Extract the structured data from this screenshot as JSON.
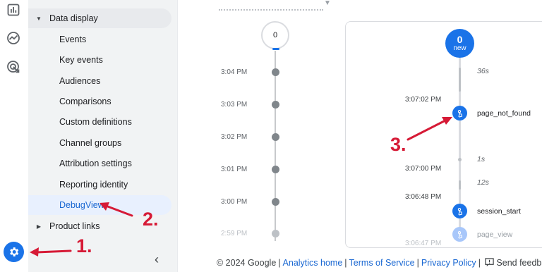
{
  "sidebar": {
    "rail_icons": [
      "reports-bar-chart-icon",
      "explore-trend-icon",
      "advertising-target-icon"
    ],
    "admin_icon": "gear-icon",
    "collapse_label": "‹"
  },
  "nav": {
    "open_section": "Data display",
    "items": [
      {
        "label": "Events"
      },
      {
        "label": "Key events"
      },
      {
        "label": "Audiences"
      },
      {
        "label": "Comparisons"
      },
      {
        "label": "Custom definitions"
      },
      {
        "label": "Channel groups"
      },
      {
        "label": "Attribution settings"
      },
      {
        "label": "Reporting identity"
      },
      {
        "label": "DebugView",
        "active": true
      }
    ],
    "closed_section": "Product links"
  },
  "minutes_stream": {
    "top_count": "0",
    "ticks": [
      "3:04 PM",
      "3:03 PM",
      "3:02 PM",
      "3:01 PM",
      "3:00 PM",
      "2:59 PM"
    ]
  },
  "seconds_stream": {
    "new_count": "0",
    "new_label": "new",
    "durations": [
      "36s",
      "1s",
      "12s"
    ],
    "events": [
      {
        "time": "3:07:02 PM",
        "name": "page_not_found"
      },
      {
        "time": "3:07:00 PM",
        "name": ""
      },
      {
        "time": "3:06:48 PM",
        "name": "session_start"
      },
      {
        "time": "3:06:47 PM",
        "name": "page_view"
      }
    ]
  },
  "annotations": [
    "1.",
    "2.",
    "3."
  ],
  "footer": {
    "copyright": "© 2024 Google",
    "links": [
      "Analytics home",
      "Terms of Service",
      "Privacy Policy"
    ],
    "feedback": "Send feedba"
  },
  "colors": {
    "accent": "#1a73e8",
    "annotation": "#d61a36",
    "nav_bg": "#f1f3f4",
    "active_bg": "#e8f0fe"
  }
}
